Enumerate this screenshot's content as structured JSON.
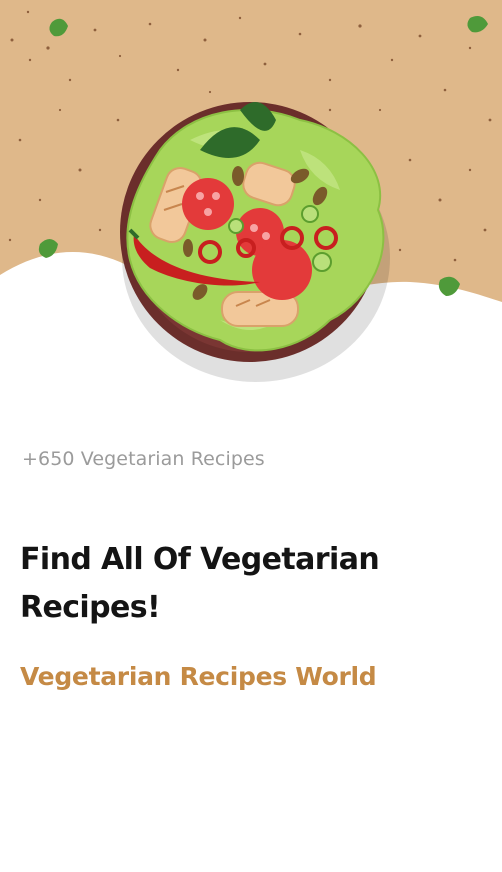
{
  "onboarding": {
    "recipe_count": "+650 Vegetarian Recipes",
    "headline": "Find All Of Vegetarian Recipes!",
    "brand_name": "Vegetarian Recipes World"
  },
  "colors": {
    "backdrop": "#dfb88a",
    "plate": "#6b2e2b",
    "lettuce": "#a7d65a",
    "accent_text": "#c58a45",
    "headline_text": "#141414",
    "muted_text": "#9b9b9b"
  },
  "icons": [
    "salad-plate-illustration",
    "herb-leaf-icon"
  ]
}
